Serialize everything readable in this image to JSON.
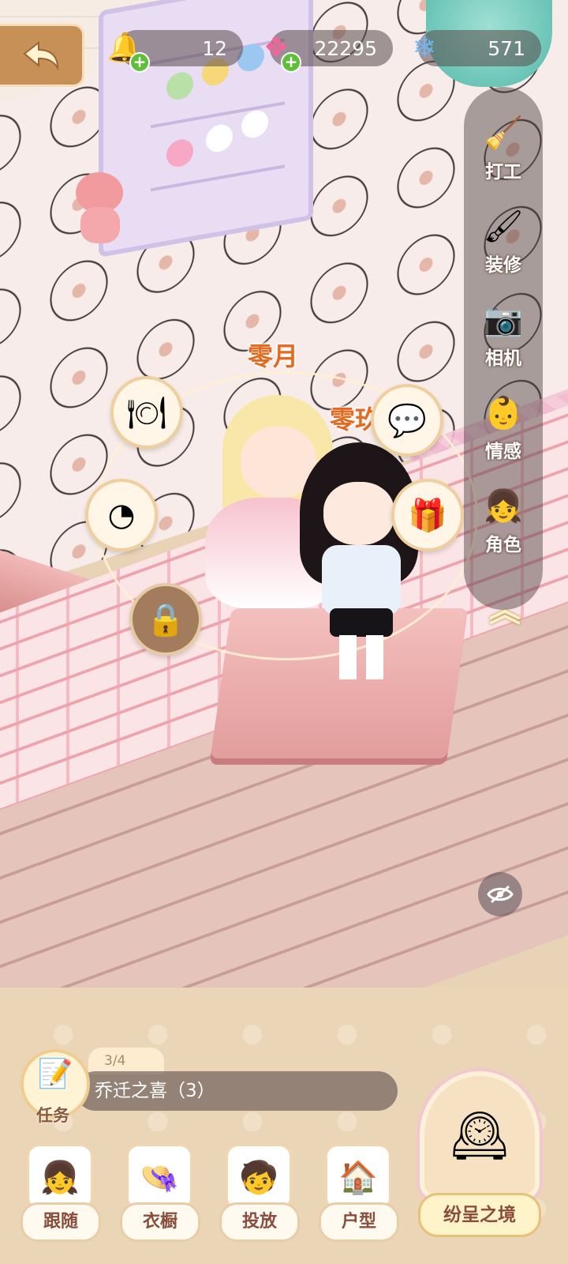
{
  "hud": {
    "resources": [
      {
        "icon": "bell-icon",
        "value": "12",
        "has_plus": true
      },
      {
        "icon": "pink-gem-icon",
        "value": "22295",
        "has_plus": true
      },
      {
        "icon": "blue-crystal-icon",
        "value": "571",
        "has_plus": false
      }
    ]
  },
  "side_menu": {
    "items": [
      {
        "label": "打工",
        "icon": "broom-icon"
      },
      {
        "label": "装修",
        "icon": "paint-roller-icon"
      },
      {
        "label": "相机",
        "icon": "camera-icon"
      },
      {
        "label": "情感",
        "icon": "emotion-doll-icon"
      },
      {
        "label": "角色",
        "icon": "character-avatar-icon"
      }
    ],
    "collapse_icon": "chevron-up-icon"
  },
  "characters": {
    "names": [
      "零月",
      "零玖"
    ]
  },
  "interaction_buttons": [
    {
      "icon": "food-cloche-icon"
    },
    {
      "icon": "pie-chart-icon"
    },
    {
      "icon": "lock-icon"
    },
    {
      "icon": "chat-bubble-icon"
    },
    {
      "icon": "gift-icon"
    }
  ],
  "task": {
    "label": "任务",
    "progress": "3/4",
    "title": "乔迁之喜（3）"
  },
  "bottom_nav": {
    "items": [
      {
        "label": "跟随",
        "icon": "character-card-icon"
      },
      {
        "label": "衣橱",
        "icon": "hat-icon"
      },
      {
        "label": "投放",
        "icon": "character-drop-icon"
      },
      {
        "label": "户型",
        "icon": "house-layout-icon"
      }
    ],
    "realm": {
      "label": "纷呈之境",
      "icon": "ornate-clock-icon"
    }
  },
  "colors": {
    "accent_orange": "#e56a1f",
    "label_brown": "#8a4d3b",
    "back_button": "#c79057"
  }
}
